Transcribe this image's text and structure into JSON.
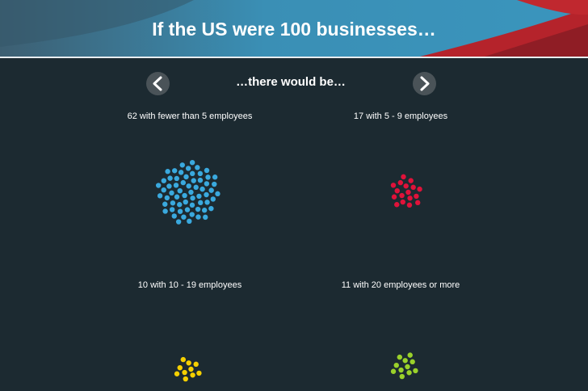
{
  "header": {
    "title": "If the US were 100 businesses…"
  },
  "nav": {
    "prev_label": "<",
    "next_label": ">",
    "subtitle": "…there would be…"
  },
  "colors": {
    "background": "#1c2a31",
    "header_blue": "#3a8fb5",
    "header_red": "#b5232b",
    "nav_button": "#4a5358"
  },
  "groups": [
    {
      "label": "62 with fewer than 5 employees",
      "count": 62,
      "color": "#3aa9de"
    },
    {
      "label": "17 with 5 - 9 employees",
      "count": 17,
      "color": "#e0123a"
    },
    {
      "label": "10 with 10 - 19 employees",
      "count": 10,
      "color": "#f5d000"
    },
    {
      "label": "11 with 20 employees or more",
      "count": 11,
      "color": "#9ad12a"
    }
  ]
}
